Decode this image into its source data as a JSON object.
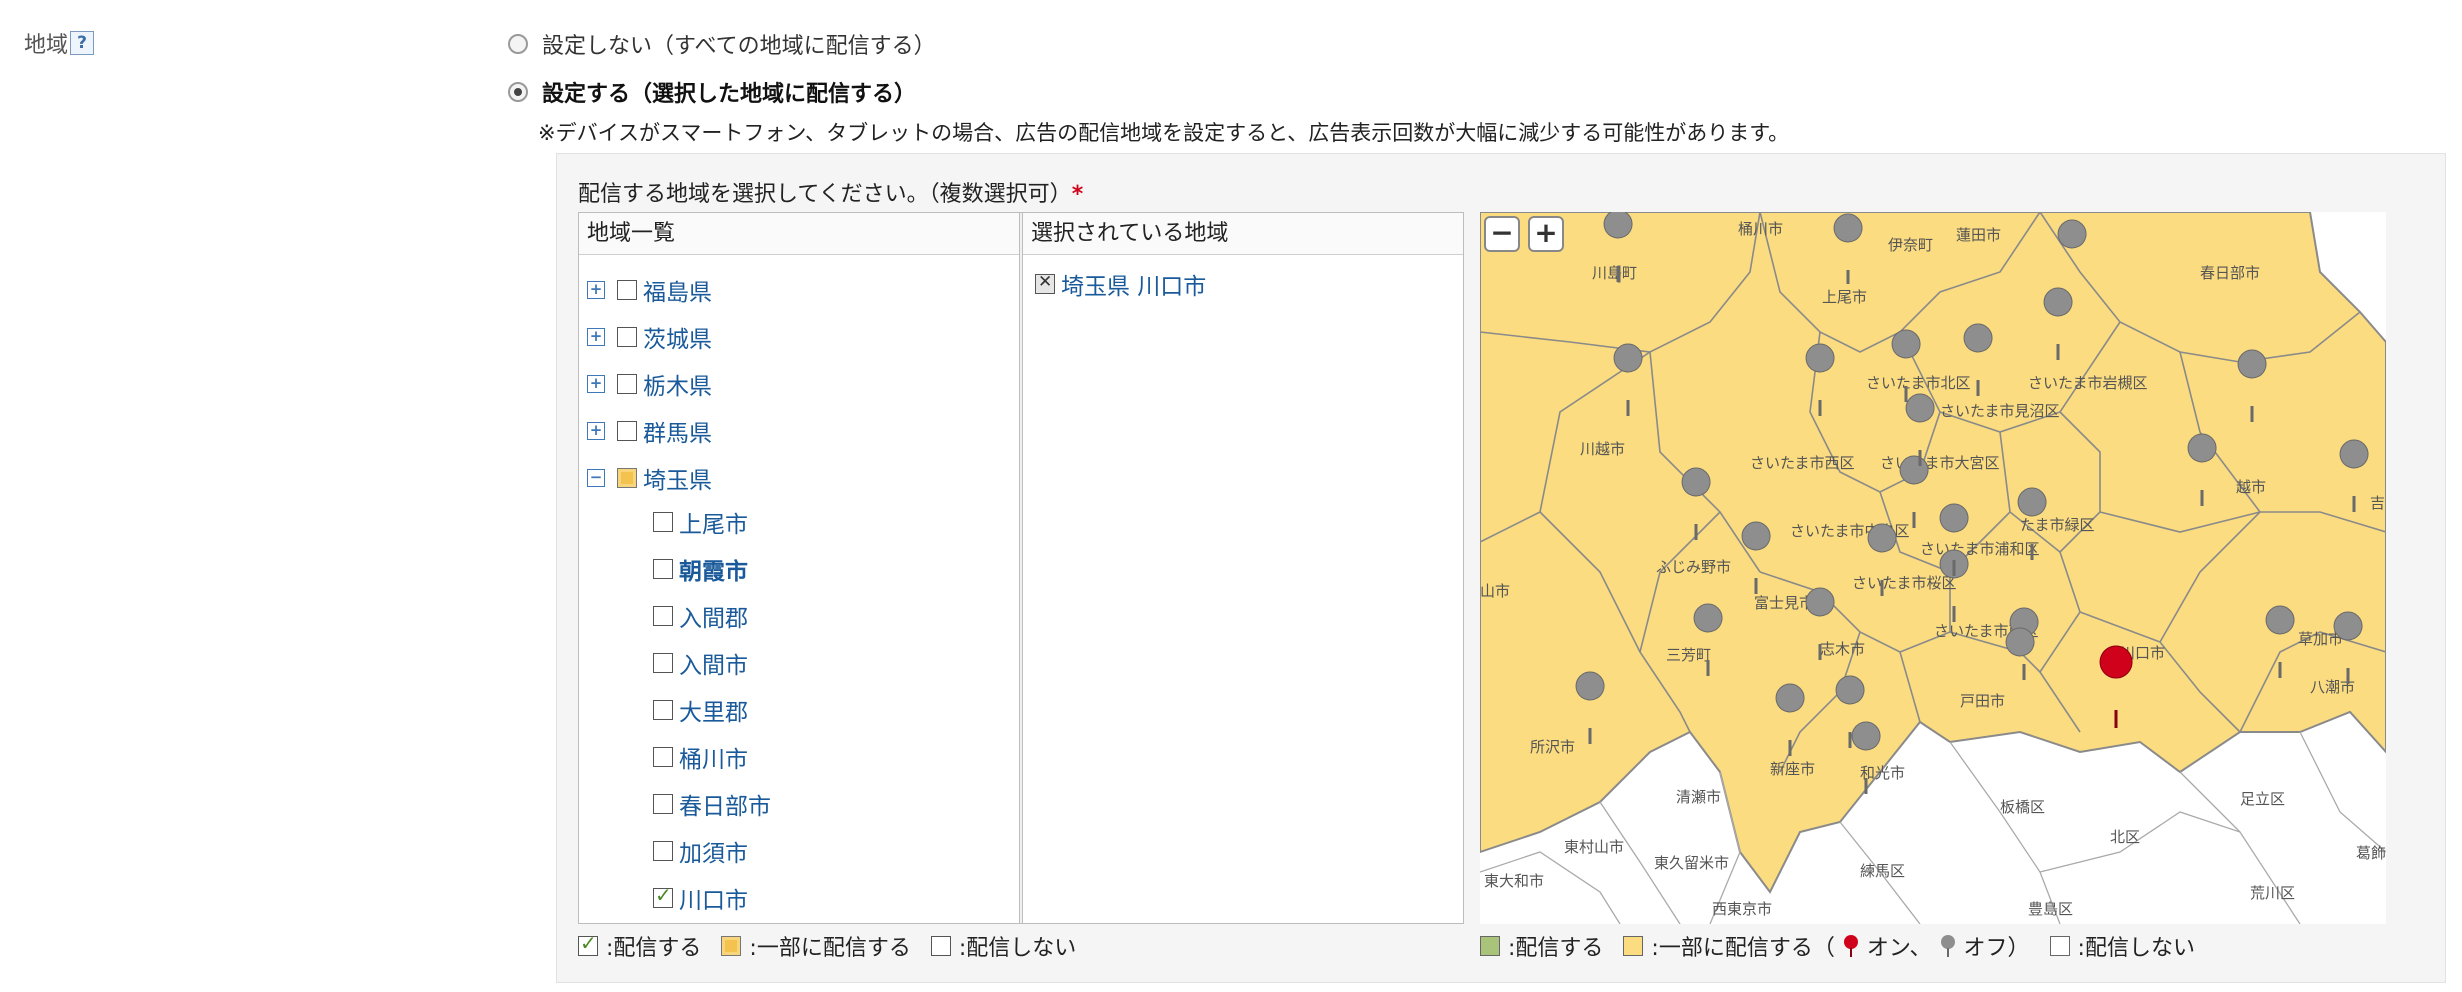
{
  "field": {
    "label": "地域",
    "help_icon": "?"
  },
  "radios": [
    {
      "label": "設定しない（すべての地域に配信する）",
      "selected": false
    },
    {
      "label": "設定する（選択した地域に配信する）",
      "selected": true
    }
  ],
  "note": "※デバイスがスマートフォン、タブレットの場合、広告の配信地域を設定すると、広告表示回数が大幅に減少する可能性があります。",
  "prompt": {
    "text": "配信する地域を選択してください。（複数選択可）",
    "required": "*"
  },
  "columns": {
    "list": "地域一覧",
    "selected": "選択されている地域"
  },
  "tree": {
    "prefectures": [
      {
        "name": "福島県",
        "expander": "+",
        "state": "none"
      },
      {
        "name": "茨城県",
        "expander": "+",
        "state": "none"
      },
      {
        "name": "栃木県",
        "expander": "+",
        "state": "none"
      },
      {
        "name": "群馬県",
        "expander": "+",
        "state": "none"
      },
      {
        "name": "埼玉県",
        "expander": "−",
        "state": "partial"
      }
    ],
    "cities": [
      {
        "name": "上尾市",
        "state": "none"
      },
      {
        "name": "朝霞市",
        "state": "none"
      },
      {
        "name": "入間郡",
        "state": "none"
      },
      {
        "name": "入間市",
        "state": "none"
      },
      {
        "name": "大里郡",
        "state": "none"
      },
      {
        "name": "桶川市",
        "state": "none"
      },
      {
        "name": "春日部市",
        "state": "none"
      },
      {
        "name": "加須市",
        "state": "none"
      },
      {
        "name": "川口市",
        "state": "checked"
      }
    ]
  },
  "selected_regions": [
    {
      "label": "埼玉県 川口市"
    }
  ],
  "legend_left": {
    "on": ":配信する",
    "partial": ":一部に配信する",
    "off": ":配信しない"
  },
  "legend_right": {
    "on": ":配信する",
    "partial_prefix": ":一部に配信する（",
    "pin_on": "オン、",
    "pin_off": "オフ）",
    "off": ":配信しない"
  },
  "map": {
    "zoom_out": "−",
    "zoom_in": "+",
    "labels": [
      "桶川市",
      "伊奈町",
      "蓮田市",
      "川島町",
      "上尾市",
      "春日部市",
      "さいたま市北区",
      "さいたま市岩槻区",
      "さいたま市見沼区",
      "川越市",
      "さいたま市西区",
      "さいたま市大宮区",
      "さいたま市中央区",
      "さいたま市浦和区",
      "さいたま市緑区",
      "ふじみ野市",
      "富士見市",
      "さいたま市桜区",
      "さいたま市南区",
      "三芳町",
      "志木市",
      "川口市",
      "八潮市",
      "草加市",
      "戸田市",
      "所沢市",
      "新座市",
      "和光市",
      "清瀬市",
      "板橋区",
      "北区",
      "足立区",
      "東村山市",
      "東久留米市",
      "練馬区",
      "東大和市",
      "西東京市",
      "豊島区",
      "荒川区",
      "葛飾",
      "山市",
      "越市",
      "吉"
    ],
    "colors": {
      "map_fill": "#fbdc80",
      "outside_fill": "#ffffff",
      "pin_off": "#8e8e8e",
      "pin_on": "#d0021b",
      "border": "#8a8a8a"
    }
  }
}
